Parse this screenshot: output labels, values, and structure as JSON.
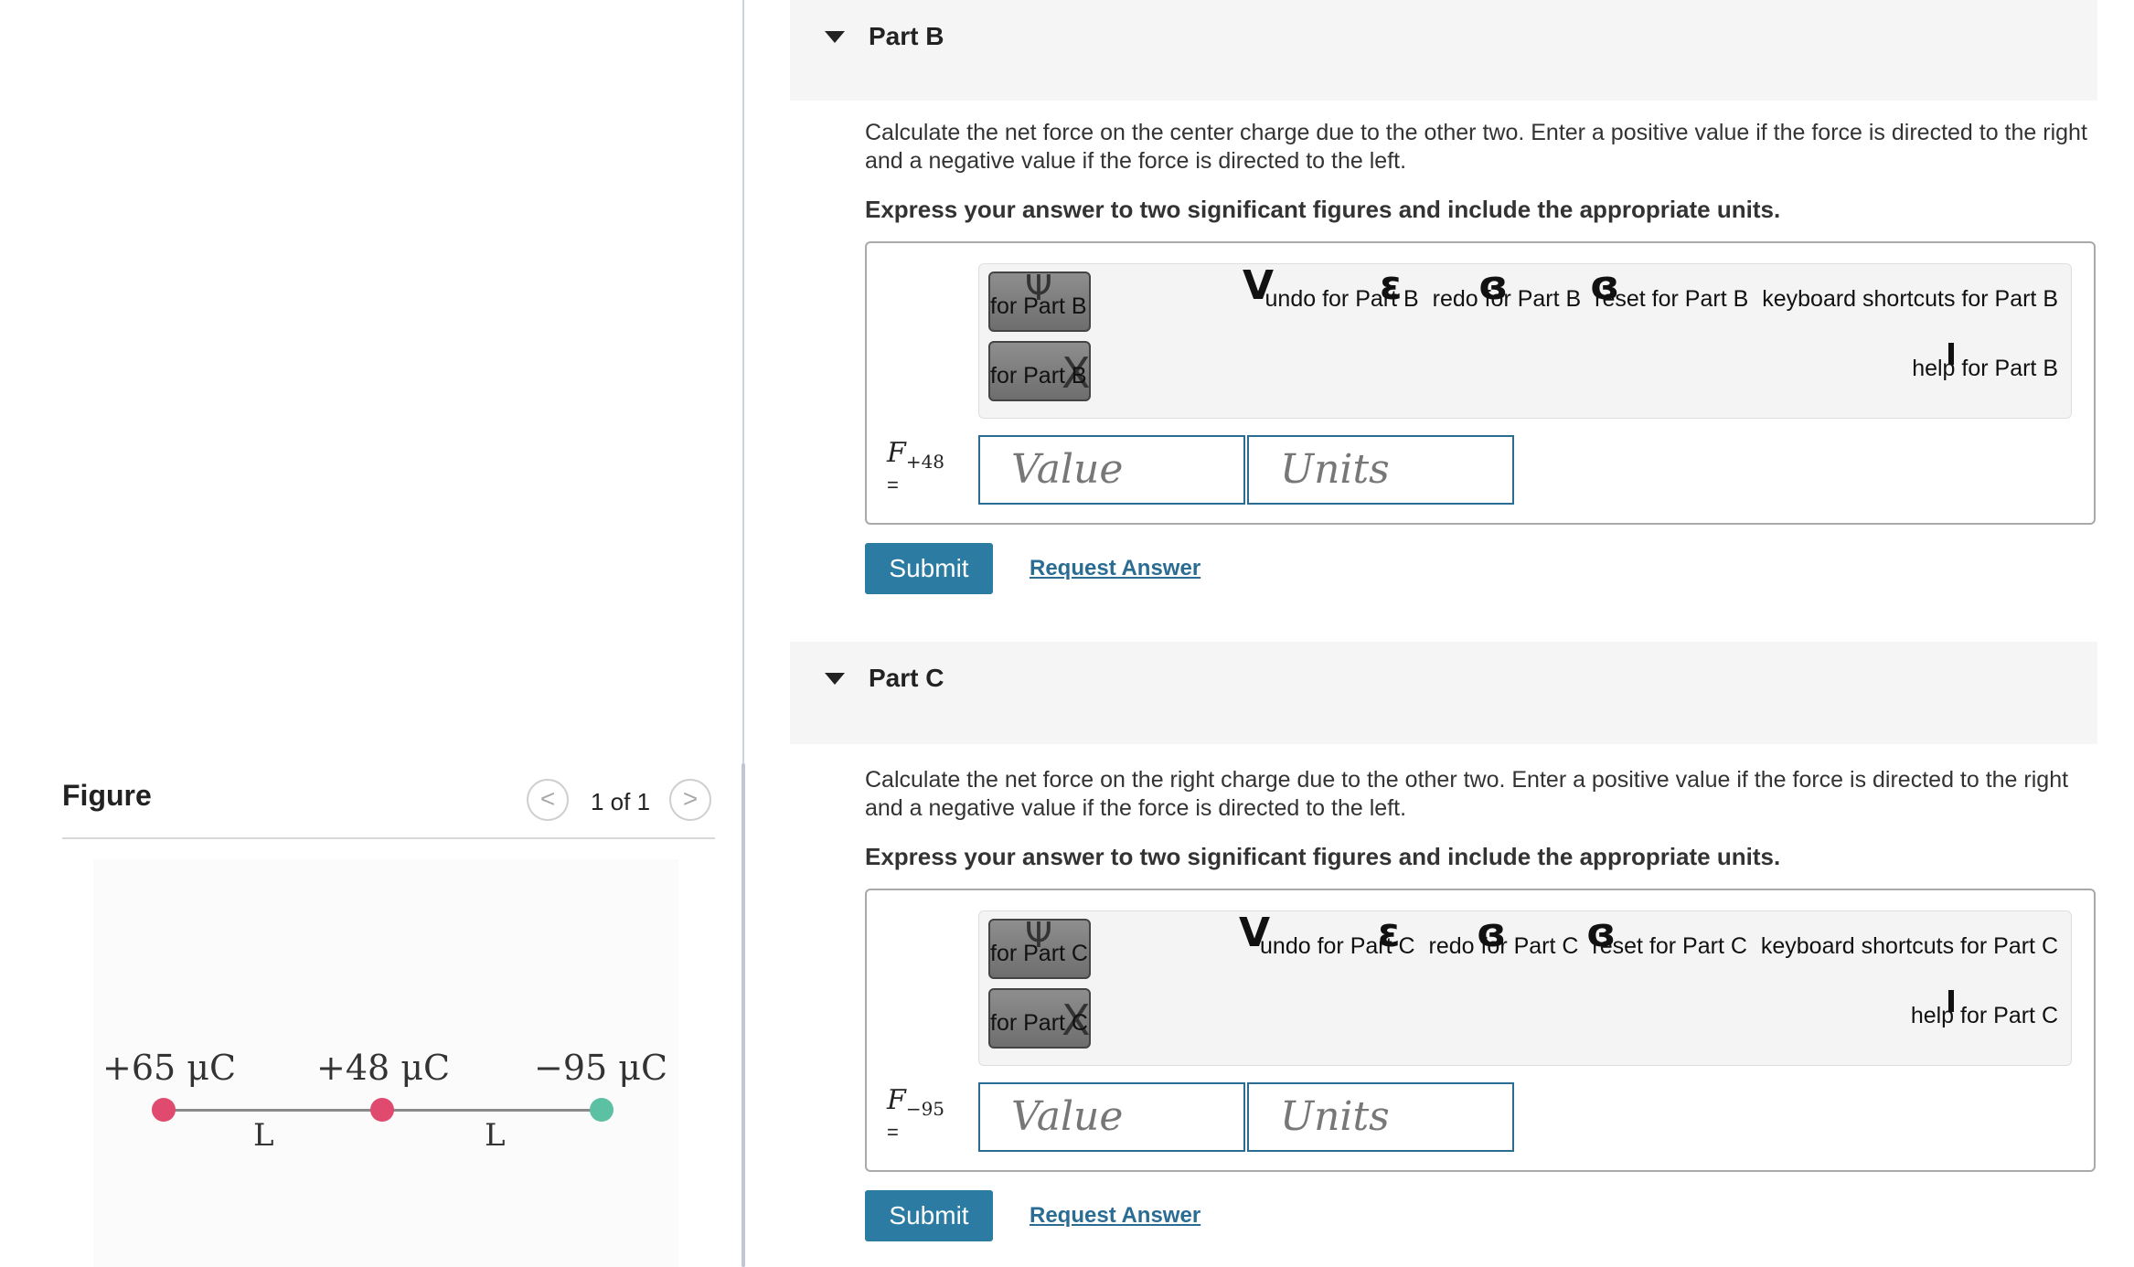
{
  "figure": {
    "title": "Figure",
    "page_count": "1 of 1",
    "prev_glyph": "<",
    "next_glyph": ">",
    "charges": [
      "+65 μC",
      "+48 μC",
      "−95 μC"
    ],
    "distances": [
      "L",
      "L"
    ],
    "colors": {
      "positive": "#e04a6e",
      "negative": "#5cc0a2"
    }
  },
  "parts": [
    {
      "title": "Part B",
      "question": "Calculate the net force on the center charge due to the other two. Enter a positive value if the force is directed to the right and a negative value if the force is directed to the left.",
      "instruction": "Express your answer to two significant figures and include the appropriate units.",
      "toolbar": {
        "templates_label": "for Part B",
        "templates_glyph": "Ψ",
        "symbols_label": "for Part B",
        "symbols_glyph": "X",
        "undo": "undo for Part B",
        "redo": "redo for Part B",
        "reset": "reset for Part B",
        "keyboard": "keyboard shortcuts for Part B",
        "help": "help for Part B"
      },
      "variable": "F",
      "variable_sub": "+48",
      "equals": "=",
      "value_placeholder": "Value",
      "units_placeholder": "Units",
      "submit": "Submit",
      "request": "Request Answer"
    },
    {
      "title": "Part C",
      "question": "Calculate the net force on the right charge due to the other two. Enter a positive value if the force is directed to the right and a negative value if the force is directed to the left.",
      "instruction": "Express your answer to two significant figures and include the appropriate units.",
      "toolbar": {
        "templates_label": "for Part C",
        "templates_glyph": "Ψ",
        "symbols_label": "for Part C",
        "symbols_glyph": "X",
        "undo": "undo for Part C",
        "redo": "redo for Part C",
        "reset": "reset for Part C",
        "keyboard": "keyboard shortcuts for Part C",
        "help": "help for Part C"
      },
      "variable": "F",
      "variable_sub": "−95",
      "equals": "=",
      "value_placeholder": "Value",
      "units_placeholder": "Units",
      "submit": "Submit",
      "request": "Request Answer"
    }
  ]
}
